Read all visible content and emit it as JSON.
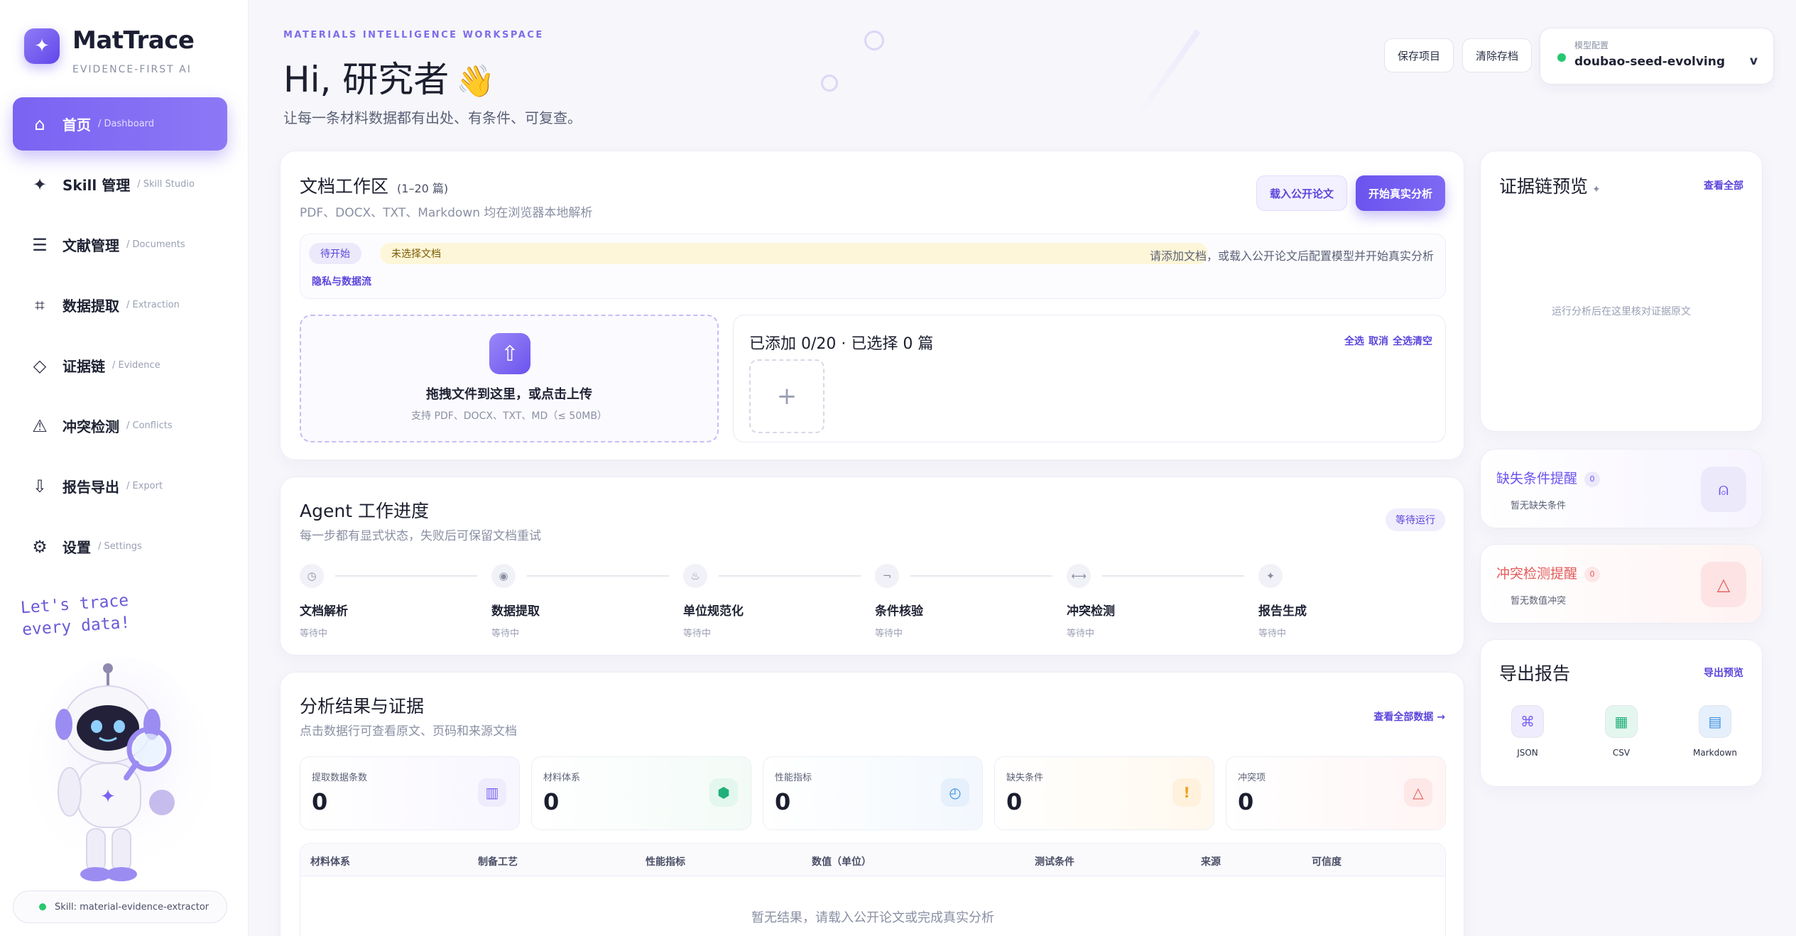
{
  "brand": {
    "name": "MatTrace",
    "tagline": "EVIDENCE-FIRST AI"
  },
  "nav": [
    {
      "label": "首页",
      "sub": "/ Dashboard",
      "icon": "home-icon",
      "glyph": "⌂",
      "active": true
    },
    {
      "label": "Skill 管理",
      "sub": "/ Skill Studio",
      "icon": "sparkle-icon",
      "glyph": "✦",
      "active": false
    },
    {
      "label": "文献管理",
      "sub": "/ Documents",
      "icon": "document-list-icon",
      "glyph": "☰",
      "active": false
    },
    {
      "label": "数据提取",
      "sub": "/ Extraction",
      "icon": "crop-icon",
      "glyph": "⌗",
      "active": false
    },
    {
      "label": "证据链",
      "sub": "/ Evidence",
      "icon": "diamond-icon",
      "glyph": "◇",
      "active": false
    },
    {
      "label": "冲突检测",
      "sub": "/ Conflicts",
      "icon": "warning-icon",
      "glyph": "⚠",
      "active": false
    },
    {
      "label": "报告导出",
      "sub": "/ Export",
      "icon": "download-icon",
      "glyph": "⇩",
      "active": false
    },
    {
      "label": "设置",
      "sub": "/ Settings",
      "icon": "gear-icon",
      "glyph": "⚙",
      "active": false
    }
  ],
  "mascot": {
    "line1": "Let's trace",
    "line2": "every data!"
  },
  "skill_status": "Skill: material-evidence-extractor",
  "header": {
    "kicker": "MATERIALS INTELLIGENCE WORKSPACE",
    "greeting": "Hi, 研究者",
    "wave": "👋",
    "subtitle": "让每一条材料数据都有出处、有条件、可复查。",
    "save_project": "保存项目",
    "clear_archive": "清除存档",
    "model_label": "模型配置",
    "model_value": "doubao-seed-evolving",
    "model_chevron": "v"
  },
  "workspace": {
    "title": "文档工作区",
    "count": "(1–20 篇)",
    "subtitle": "PDF、DOCX、TXT、Markdown 均在浏览器本地解析",
    "load_public": "载入公开论文",
    "start_analysis": "开始真实分析",
    "status_badge": "待开始",
    "status_bar": "未选择文档",
    "status_hint": "请添加文档，或载入公开论文后配置模型并开始真实分析",
    "privacy_link": "隐私与数据流",
    "upload_title": "拖拽文件到这里，或点击上传",
    "upload_sub": "支持 PDF、DOCX、TXT、MD（≤ 50MB）",
    "files_title": "已添加 0/20 · 已选择 0 篇",
    "select_all": "全选",
    "deselect": "取消",
    "clear_all": "全选清空",
    "add_plus": "+"
  },
  "agent": {
    "title": "Agent 工作进度",
    "subtitle": "每一步都有显式状态，失败后可保留文档重试",
    "status": "等待运行",
    "steps": [
      {
        "name": "文档解析",
        "state": "等待中",
        "icon": "clock-icon",
        "glyph": "◷"
      },
      {
        "name": "数据提取",
        "state": "等待中",
        "icon": "target-icon",
        "glyph": "◉"
      },
      {
        "name": "单位规范化",
        "state": "等待中",
        "icon": "flask-icon",
        "glyph": "♨"
      },
      {
        "name": "条件核验",
        "state": "等待中",
        "icon": "check-icon",
        "glyph": "¬"
      },
      {
        "name": "冲突检测",
        "state": "等待中",
        "icon": "arrows-icon",
        "glyph": "⟷"
      },
      {
        "name": "报告生成",
        "state": "等待中",
        "icon": "sparkle-icon",
        "glyph": "✦"
      }
    ]
  },
  "results": {
    "title": "分析结果与证据",
    "subtitle": "点击数据行可查看原文、页码和来源文档",
    "view_all": "查看全部数据 →",
    "metrics": [
      {
        "label": "提取数据条数",
        "value": "0",
        "icon": "barcode-icon",
        "glyph": "▥",
        "color": "#7a63f2",
        "bg": "#efecfd"
      },
      {
        "label": "材料体系",
        "value": "0",
        "icon": "cube-icon",
        "glyph": "⬢",
        "color": "#21b07a",
        "bg": "#e3f7ee"
      },
      {
        "label": "性能指标",
        "value": "0",
        "icon": "gauge-icon",
        "glyph": "◴",
        "color": "#3b8fe0",
        "bg": "#e5f0fc"
      },
      {
        "label": "缺失条件",
        "value": "0",
        "icon": "exclamation-icon",
        "glyph": "!",
        "color": "#f0a020",
        "bg": "#fff1dc"
      },
      {
        "label": "冲突项",
        "value": "0",
        "icon": "triangle-icon",
        "glyph": "△",
        "color": "#e35b5b",
        "bg": "#fde7e7"
      }
    ],
    "columns": [
      "材料体系",
      "制备工艺",
      "性能指标",
      "数值（单位）",
      "测试条件",
      "来源",
      "可信度"
    ],
    "empty": "暂无结果，请载入公开论文或完成真实分析"
  },
  "evidence": {
    "title": "证据链预览",
    "sparkle": "✦",
    "view_all": "查看全部",
    "hint": "运行分析后在这里核对证据原文"
  },
  "missing_alert": {
    "title": "缺失条件提醒",
    "count": "0",
    "sub": "暂无缺失条件",
    "glyph": "⍝"
  },
  "conflict_alert": {
    "title": "冲突检测提醒",
    "count": "0",
    "sub": "暂无数值冲突",
    "glyph": "△"
  },
  "export": {
    "title": "导出报告",
    "preview": "导出预览",
    "items": [
      {
        "label": "JSON",
        "icon": "json-icon",
        "glyph": "⌘",
        "color": "#7a63f2",
        "bg": "#efecfd"
      },
      {
        "label": "CSV",
        "icon": "grid-icon",
        "glyph": "▦",
        "color": "#21b07a",
        "bg": "#e3f7ee"
      },
      {
        "label": "Markdown",
        "icon": "markdown-icon",
        "glyph": "▤",
        "color": "#3b8fe0",
        "bg": "#e5f0fc"
      }
    ]
  }
}
